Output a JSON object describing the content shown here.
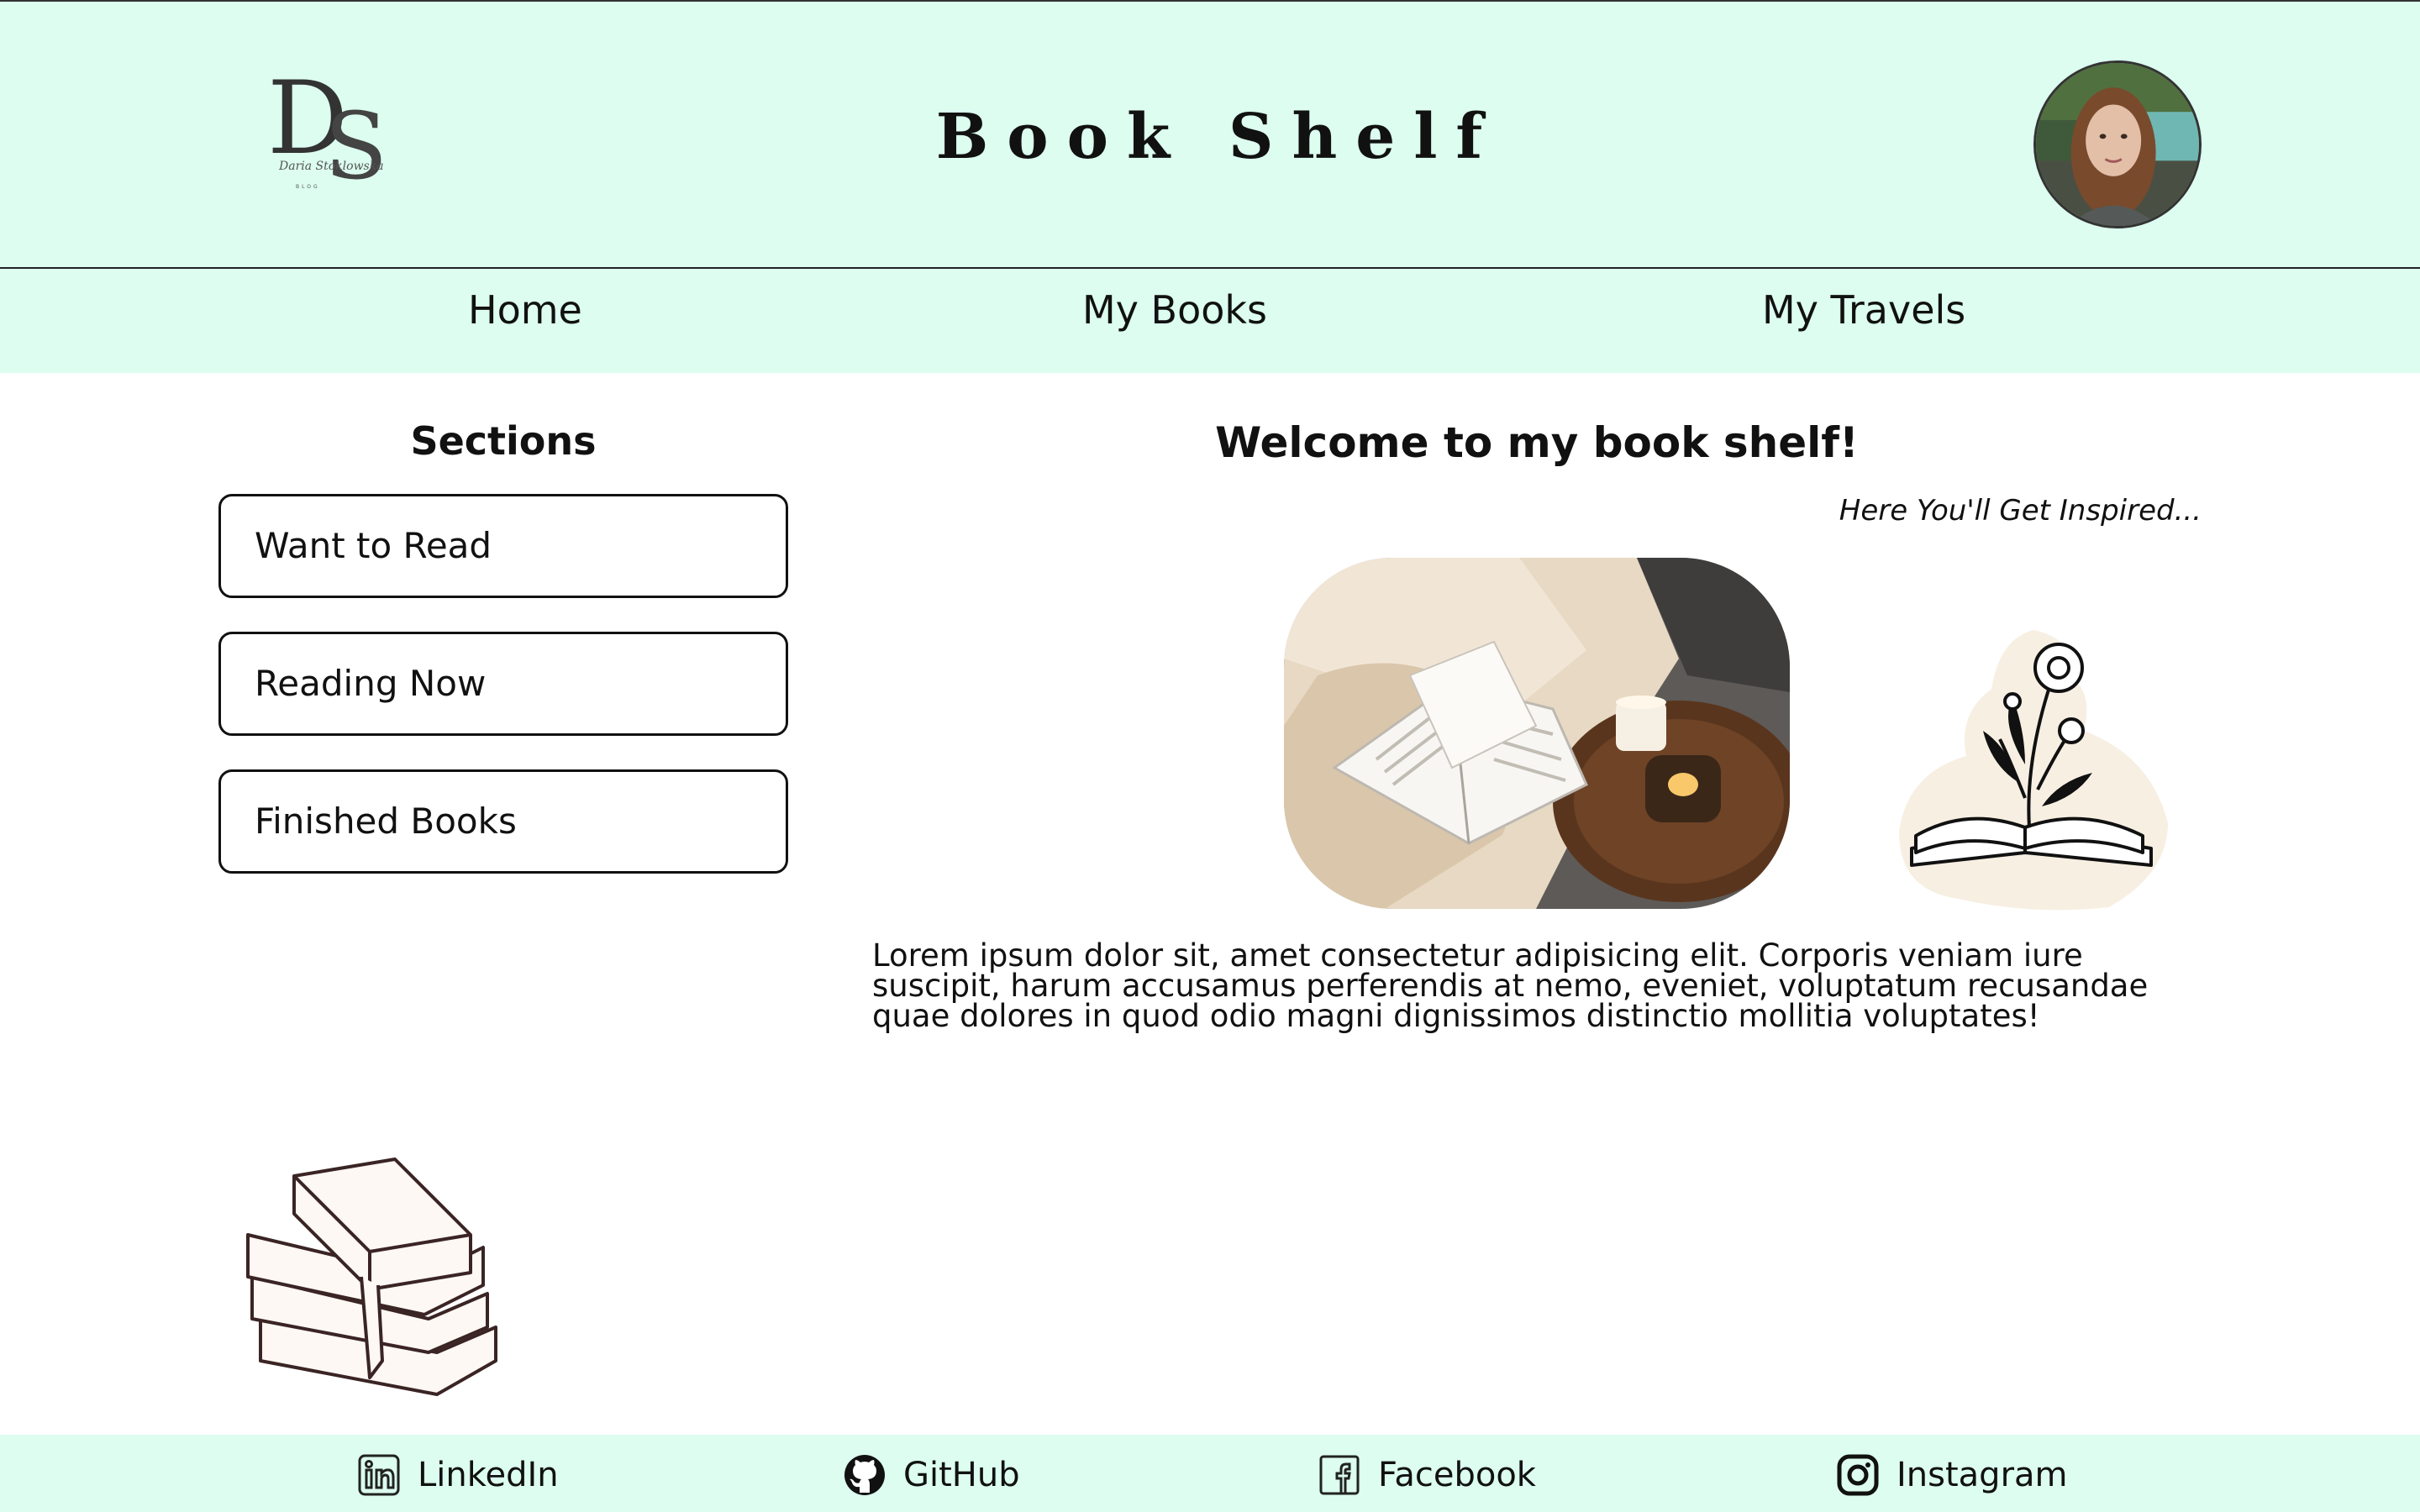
{
  "header": {
    "title": "Book Shelf",
    "logo_text": "Daria Stoklowska",
    "logo_subtext": "BLOG"
  },
  "nav": {
    "items": [
      {
        "label": "Home"
      },
      {
        "label": "My Books"
      },
      {
        "label": "My Travels"
      }
    ]
  },
  "sidebar": {
    "title": "Sections",
    "items": [
      {
        "label": "Want to Read"
      },
      {
        "label": "Reading Now"
      },
      {
        "label": "Finished Books"
      }
    ]
  },
  "main": {
    "heading": "Welcome to my book shelf!",
    "tagline": "Here You'll Get Inspired...",
    "body": "Lorem ipsum dolor sit, amet consectetur adipisicing elit. Corporis veniam iure suscipit, harum accusamus perferendis at nemo, eveniet, voluptatum recusandae quae dolores in quod odio magni dignissimos distinctio mollitia voluptates!"
  },
  "footer": {
    "links": [
      {
        "label": "LinkedIn",
        "icon": "linkedin-icon"
      },
      {
        "label": "GitHub",
        "icon": "github-icon"
      },
      {
        "label": "Facebook",
        "icon": "facebook-icon"
      },
      {
        "label": "Instagram",
        "icon": "instagram-icon"
      }
    ]
  },
  "colors": {
    "header_bg": "#dcfdf0",
    "text": "#111111",
    "background": "#ffffff"
  }
}
